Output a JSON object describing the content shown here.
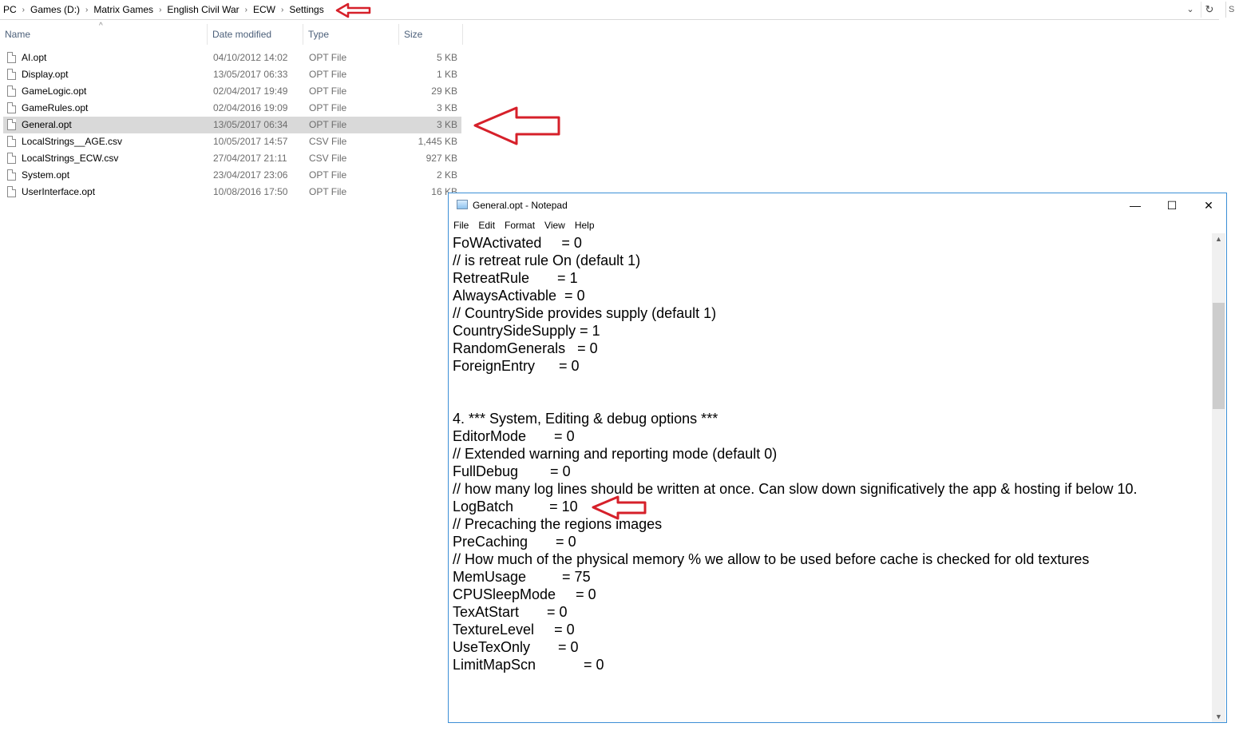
{
  "address_bar": {
    "crumbs": [
      "PC",
      "Games (D:)",
      "Matrix Games",
      "English Civil War",
      "ECW",
      "Settings"
    ],
    "dropdown_icon": "chevron-down-icon",
    "refresh_icon": "refresh-icon",
    "search_stub": "S"
  },
  "columns": {
    "name": "Name",
    "date": "Date modified",
    "type": "Type",
    "size": "Size"
  },
  "files": [
    {
      "name": "AI.opt",
      "date": "04/10/2012 14:02",
      "type": "OPT File",
      "size": "5 KB",
      "selected": false
    },
    {
      "name": "Display.opt",
      "date": "13/05/2017 06:33",
      "type": "OPT File",
      "size": "1 KB",
      "selected": false
    },
    {
      "name": "GameLogic.opt",
      "date": "02/04/2017 19:49",
      "type": "OPT File",
      "size": "29 KB",
      "selected": false
    },
    {
      "name": "GameRules.opt",
      "date": "02/04/2016 19:09",
      "type": "OPT File",
      "size": "3 KB",
      "selected": false
    },
    {
      "name": "General.opt",
      "date": "13/05/2017 06:34",
      "type": "OPT File",
      "size": "3 KB",
      "selected": true
    },
    {
      "name": "LocalStrings__AGE.csv",
      "date": "10/05/2017 14:57",
      "type": "CSV File",
      "size": "1,445 KB",
      "selected": false
    },
    {
      "name": "LocalStrings_ECW.csv",
      "date": "27/04/2017 21:11",
      "type": "CSV File",
      "size": "927 KB",
      "selected": false
    },
    {
      "name": "System.opt",
      "date": "23/04/2017 23:06",
      "type": "OPT File",
      "size": "2 KB",
      "selected": false
    },
    {
      "name": "UserInterface.opt",
      "date": "10/08/2016 17:50",
      "type": "OPT File",
      "size": "16 KB",
      "selected": false
    }
  ],
  "notepad": {
    "title": "General.opt - Notepad",
    "controls": {
      "minimize": "—",
      "maximize": "☐",
      "close": "✕"
    },
    "menu": [
      "File",
      "Edit",
      "Format",
      "View",
      "Help"
    ],
    "lines": [
      "FoWActivated     = 0",
      "// is retreat rule On (default 1)",
      "RetreatRule       = 1",
      "AlwaysActivable  = 0",
      "// CountrySide provides supply (default 1)",
      "CountrySideSupply = 1",
      "RandomGenerals   = 0",
      "ForeignEntry      = 0",
      "",
      "",
      "4. *** System, Editing & debug options ***",
      "EditorMode       = 0",
      "// Extended warning and reporting mode (default 0)",
      "FullDebug        = 0",
      "// how many log lines should be written at once. Can slow down significatively the app & hosting if below 10.",
      "LogBatch         = 10",
      "// Precaching the regions images",
      "PreCaching       = 0",
      "// How much of the physical memory % we allow to be used before cache is checked for old textures",
      "MemUsage         = 75",
      "CPUSleepMode     = 0",
      "TexAtStart       = 0",
      "TextureLevel     = 0",
      "UseTexOnly       = 0",
      "LimitMapScn            = 0"
    ]
  },
  "annotation_color": "#d6202a"
}
